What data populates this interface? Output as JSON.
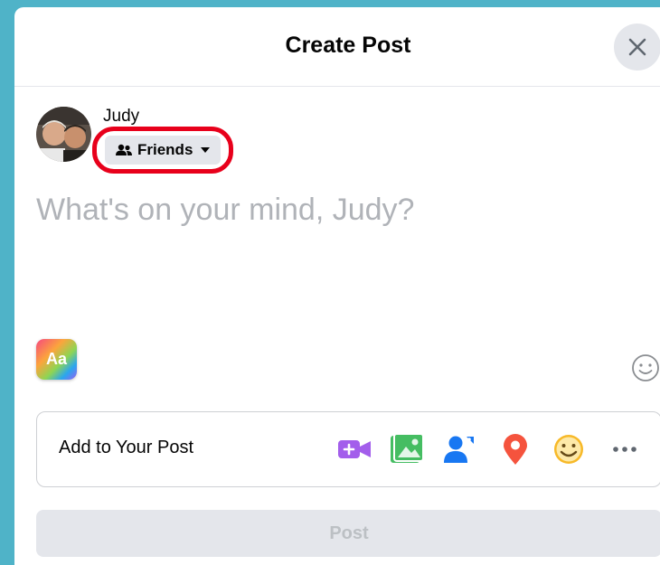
{
  "dialog": {
    "title": "Create Post",
    "close_icon": "close-icon"
  },
  "user": {
    "name": "Judy",
    "avatar": "avatar-photo"
  },
  "audience": {
    "label": "Friends",
    "icon": "friends-icon",
    "caret_icon": "caret-down-icon",
    "highlight_color": "#e8001b"
  },
  "composer": {
    "placeholder": "What's on your mind, Judy?"
  },
  "background_button": {
    "label": "Aa"
  },
  "add_to_post": {
    "label": "Add to Your Post",
    "icons": [
      "live-video-icon",
      "photo-video-icon",
      "tag-people-icon",
      "check-in-icon",
      "feeling-activity-icon",
      "more-icon"
    ],
    "colors": {
      "live_video": "#a35eeb",
      "photo": "#45bd62",
      "tag": "#1877f2",
      "checkin": "#f5533d",
      "feeling": "#f7b928",
      "more": "#606770"
    }
  },
  "post_button": {
    "label": "Post"
  }
}
